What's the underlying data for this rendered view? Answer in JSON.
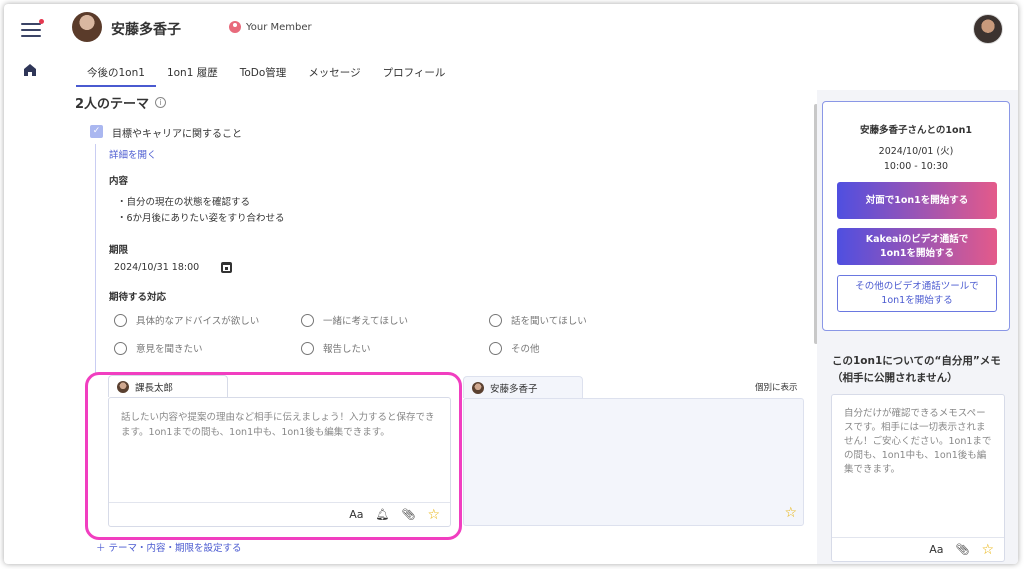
{
  "header": {
    "user_name": "安藤多香子",
    "member_label": "Your Member"
  },
  "tabs": [
    {
      "label": "今後の1on1"
    },
    {
      "label": "1on1 履歴"
    },
    {
      "label": "ToDo管理"
    },
    {
      "label": "メッセージ"
    },
    {
      "label": "プロフィール"
    }
  ],
  "section_title": "2人のテーマ",
  "topic": {
    "label": "目標やキャリアに関すること",
    "details_link": "詳細を開く",
    "content_label": "内容",
    "content_items": [
      "・自分の現在の状態を確認する",
      "・6か月後にありたい姿をすり合わせる"
    ],
    "deadline_label": "期限",
    "deadline_value": "2024/10/31 18:00",
    "expected_label": "期待する対応",
    "options": [
      "具体的なアドバイスが欲しい",
      "一緒に考えてほしい",
      "話を聞いてほしい",
      "意見を聞きたい",
      "報告したい",
      "その他"
    ]
  },
  "memo": {
    "my_tab": "課長太郎",
    "placeholder": "話したい内容や提案の理由など相手に伝えましょう！入力すると保存できます。1on1までの間も、1on1中も、1on1後も編集できます。",
    "toolbar_text": "Aa",
    "other_tab": "安藤多香子",
    "individual_link": "個別に表示",
    "add_link": "＋ テーマ・内容・期限を設定する"
  },
  "meeting": {
    "title": "安藤多香子さんとの1on1",
    "date": "2024/10/01 (火)",
    "time": "10:00 - 10:30",
    "btn_face": "対面で1on1を開始する",
    "btn_video_1": "Kakeaiのビデオ通話で",
    "btn_video_2": "1on1を開始する",
    "btn_other_1": "その他のビデオ通話ツールで",
    "btn_other_2": "1on1を開始する"
  },
  "self_memo": {
    "title_1": "この1on1についての“自分用”メモ",
    "title_2": "（相手に公開されません）",
    "placeholder": "自分だけが確認できるメモスペースです。相手には一切表示されません！ご安心ください。1on1までの間も、1on1中も、1on1後も編集できます。",
    "toolbar_text": "Aa"
  },
  "colors": {
    "accent": "#4a5ad0",
    "highlight": "#f13ec0",
    "gradient_start": "#4f4fe0",
    "gradient_end": "#e45a8a"
  }
}
